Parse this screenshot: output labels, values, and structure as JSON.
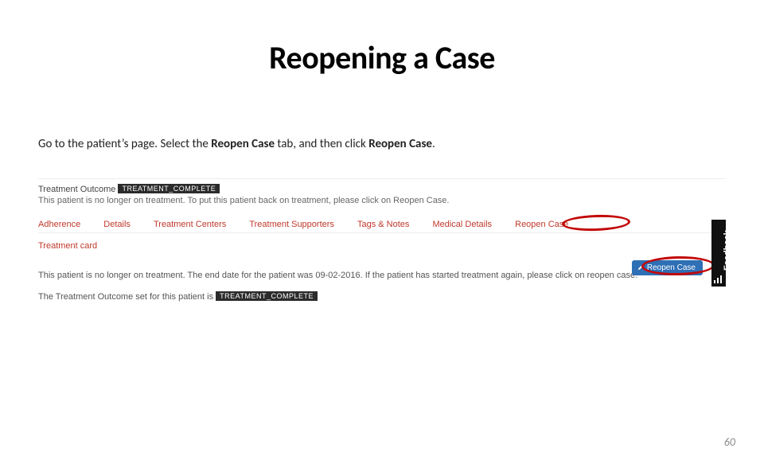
{
  "title": "Reopening a Case",
  "instr": {
    "pre": "Go to the patient’s page. Select the ",
    "bold1": "Reopen Case",
    "mid": " tab, and then click ",
    "bold2": "Reopen Case",
    "post": "."
  },
  "shot": {
    "outcome_label": "Treatment Outcome",
    "outcome_badge": "TREATMENT_COMPLETE",
    "outcome_sub": "This patient is no longer on treatment. To put this patient back on treatment, please click on Reopen Case.",
    "tabs": [
      "Adherence",
      "Details",
      "Treatment Centers",
      "Treatment Supporters",
      "Tags & Notes",
      "Medical Details",
      "Reopen Case"
    ],
    "treatment_card": "Treatment card",
    "para1": "This patient is no longer on treatment. The end date for the patient was 09-02-2016. If the patient has started treatment again, please click on reopen case.",
    "para2_pre": "The Treatment Outcome set for this patient is ",
    "para2_badge": "TREATMENT_COMPLETE",
    "reopen_btn": "Reopen Case",
    "feedback_label": "Feedback"
  },
  "page_number": "60"
}
